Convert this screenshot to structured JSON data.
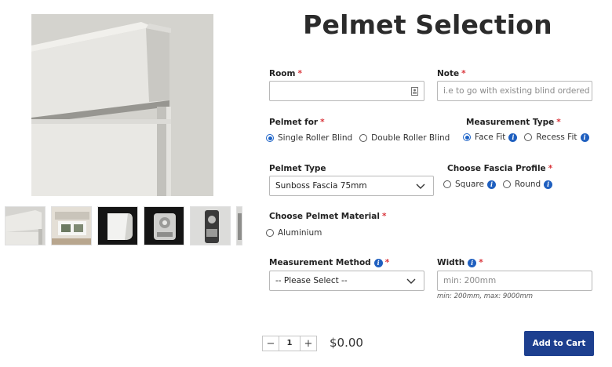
{
  "page": {
    "title": "Pelmet Selection"
  },
  "room": {
    "label": "Room",
    "value": ""
  },
  "note": {
    "label": "Note",
    "placeholder": "i.e to go with existing blind ordered"
  },
  "pelmet_for": {
    "label": "Pelmet for",
    "options": [
      "Single Roller Blind",
      "Double Roller Blind"
    ],
    "selected": "Single Roller Blind"
  },
  "measurement_type": {
    "label": "Measurement Type",
    "options": [
      "Face Fit",
      "Recess Fit"
    ],
    "selected": "Face Fit"
  },
  "pelmet_type": {
    "label": "Pelmet Type",
    "value": "Sunboss Fascia 75mm"
  },
  "fascia_profile": {
    "label": "Choose Fascia Profile",
    "options": [
      "Square",
      "Round"
    ]
  },
  "pelmet_material": {
    "label": "Choose Pelmet Material",
    "options": [
      "Aluminium"
    ]
  },
  "measurement_method": {
    "label": "Measurement Method",
    "value": "-- Please Select --"
  },
  "width": {
    "label": "Width",
    "placeholder": "min: 200mm",
    "hint": "min: 200mm, max: 9000mm"
  },
  "quantity": {
    "value": "1",
    "minus": "−",
    "plus": "+"
  },
  "price": "$0.00",
  "cart": {
    "label": "Add to Cart"
  },
  "required_mark": "*",
  "info_glyph": "i",
  "colors": {
    "accent": "#1d63c7",
    "button": "#1d3f8f",
    "required": "#d9343a"
  }
}
